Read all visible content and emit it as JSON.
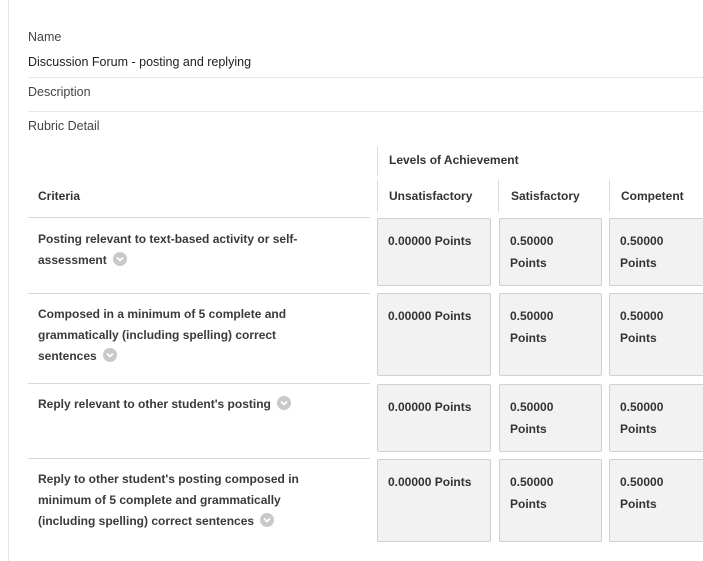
{
  "name_label": "Name",
  "name_value": "Discussion Forum - posting and replying",
  "description_label": "Description",
  "rubric_detail_label": "Rubric Detail",
  "levels_header": "Levels of Achievement",
  "criteria_header": "Criteria",
  "levels": [
    "Unsatisfactory",
    "Satisfactory",
    "Competent"
  ],
  "rows": [
    {
      "criterion": "Posting relevant to text-based activity or self-assessment",
      "cells": [
        {
          "value": "0.00000",
          "unit": "Points"
        },
        {
          "value": "0.50000",
          "unit": "Points"
        },
        {
          "value": "0.50000",
          "unit": "Points"
        }
      ]
    },
    {
      "criterion": "Composed in a minimum of 5 complete and grammatically (including spelling) correct sentences",
      "cells": [
        {
          "value": "0.00000",
          "unit": "Points"
        },
        {
          "value": "0.50000",
          "unit": "Points"
        },
        {
          "value": "0.50000",
          "unit": "Points"
        }
      ]
    },
    {
      "criterion": "Reply relevant to other student's posting",
      "cells": [
        {
          "value": "0.00000",
          "unit": "Points"
        },
        {
          "value": "0.50000",
          "unit": "Points"
        },
        {
          "value": "0.50000",
          "unit": "Points"
        }
      ]
    },
    {
      "criterion": "Reply to other student's posting composed in minimum of 5 complete and grammatically (including spelling) correct sentences",
      "cells": [
        {
          "value": "0.00000",
          "unit": "Points"
        },
        {
          "value": "0.50000",
          "unit": "Points"
        },
        {
          "value": "0.50000",
          "unit": "Points"
        }
      ]
    }
  ],
  "colors": {
    "cell_bg": "#f2f2f2",
    "cell_border": "#d0d0d0",
    "chevron": "#c9c9c9"
  }
}
